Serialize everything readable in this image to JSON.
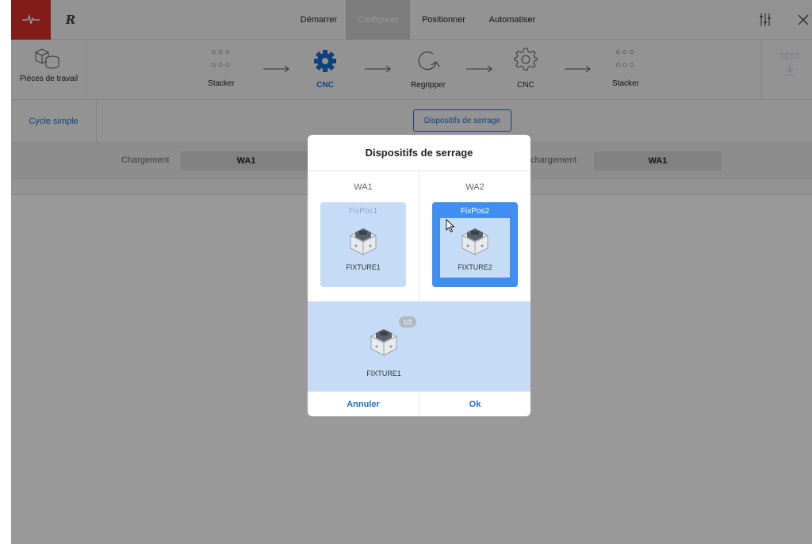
{
  "topbar": {
    "brand_mark": "R",
    "nav": [
      "Démarrer",
      "Configurer",
      "Positionner",
      "Automatiser"
    ],
    "active_nav_index": 1
  },
  "workflow": {
    "workpieces_label": "Pièces de travail",
    "steps": [
      {
        "label": "Stacker",
        "icon": "dots-grid-icon"
      },
      {
        "label": "CNC",
        "icon": "gear-icon",
        "active": true
      },
      {
        "label": "Regripper",
        "icon": "regrip-icon"
      },
      {
        "label": "CNC",
        "icon": "gear-outline-icon"
      },
      {
        "label": "Stacker",
        "icon": "dots-grid-icon"
      }
    ],
    "dots_text": "○○○",
    "test_label": "TEST"
  },
  "cycle": {
    "simple_label": "Cycle simple",
    "dispositifs_button": "Dispositifs de serrage"
  },
  "loading": {
    "charge_label": "Chargement",
    "charge_value": "WA1",
    "decharge_label": "Déchargement",
    "decharge_value": "WA1"
  },
  "modal": {
    "title": "Dispositifs de serrage",
    "columns": [
      {
        "head": "WA1",
        "pos": "FixPos1",
        "fixture": "FIXTURE1",
        "selected": false
      },
      {
        "head": "WA2",
        "pos": "FixPos2",
        "fixture": "FIXTURE2",
        "selected": true
      }
    ],
    "pool": {
      "fixture": "FIXTURE1",
      "badge": "1/2"
    },
    "cancel_label": "Annuler",
    "ok_label": "Ok"
  },
  "colors": {
    "brand_red": "#d8302a",
    "accent_blue": "#1a6fd1",
    "selected_blue": "#3f8ef0",
    "light_blue": "#c6dcf6"
  }
}
